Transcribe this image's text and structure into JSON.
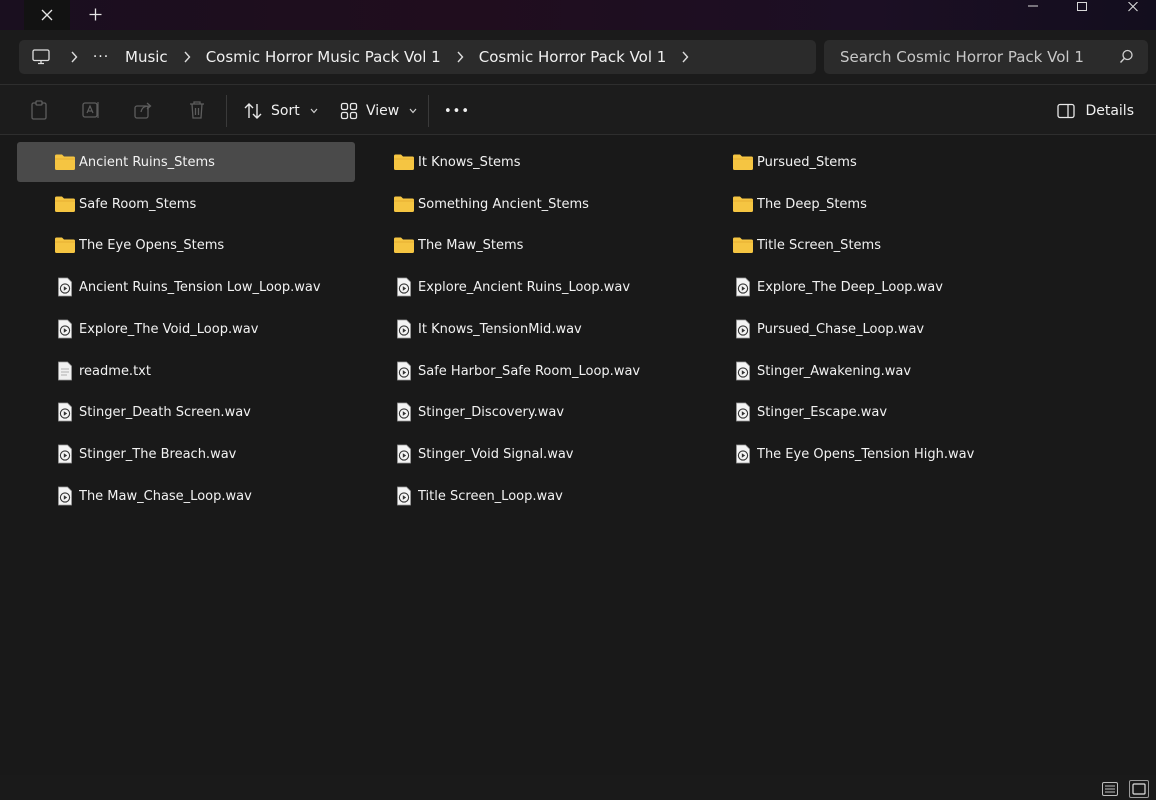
{
  "breadcrumb": {
    "more": "···",
    "segments": [
      "Music",
      "Cosmic Horror Music Pack Vol 1",
      "Cosmic Horror Pack Vol 1"
    ]
  },
  "search": {
    "placeholder": "Search Cosmic Horror Pack Vol 1"
  },
  "toolbar": {
    "sort_label": "Sort",
    "view_label": "View",
    "more_label": "•••",
    "details_label": "Details"
  },
  "colors": {
    "folder": "#f5c542",
    "accent_selected": "#4a4a4a"
  },
  "items": [
    {
      "name": "Ancient Ruins_Stems",
      "type": "folder",
      "selected": true
    },
    {
      "name": "It Knows_Stems",
      "type": "folder"
    },
    {
      "name": "Pursued_Stems",
      "type": "folder"
    },
    {
      "name": "Safe Room_Stems",
      "type": "folder"
    },
    {
      "name": "Something Ancient_Stems",
      "type": "folder"
    },
    {
      "name": "The Deep_Stems",
      "type": "folder"
    },
    {
      "name": "The Eye Opens_Stems",
      "type": "folder"
    },
    {
      "name": "The Maw_Stems",
      "type": "folder"
    },
    {
      "name": "Title Screen_Stems",
      "type": "folder"
    },
    {
      "name": "Ancient Ruins_Tension Low_Loop.wav",
      "type": "audio"
    },
    {
      "name": "Explore_Ancient Ruins_Loop.wav",
      "type": "audio"
    },
    {
      "name": "Explore_The Deep_Loop.wav",
      "type": "audio"
    },
    {
      "name": "Explore_The Void_Loop.wav",
      "type": "audio"
    },
    {
      "name": "It Knows_TensionMid.wav",
      "type": "audio"
    },
    {
      "name": "Pursued_Chase_Loop.wav",
      "type": "audio"
    },
    {
      "name": "readme.txt",
      "type": "text"
    },
    {
      "name": "Safe Harbor_Safe Room_Loop.wav",
      "type": "audio"
    },
    {
      "name": "Stinger_Awakening.wav",
      "type": "audio"
    },
    {
      "name": "Stinger_Death Screen.wav",
      "type": "audio"
    },
    {
      "name": "Stinger_Discovery.wav",
      "type": "audio"
    },
    {
      "name": "Stinger_Escape.wav",
      "type": "audio"
    },
    {
      "name": "Stinger_The Breach.wav",
      "type": "audio"
    },
    {
      "name": "Stinger_Void Signal.wav",
      "type": "audio"
    },
    {
      "name": "The Eye Opens_Tension High.wav",
      "type": "audio"
    },
    {
      "name": "The Maw_Chase_Loop.wav",
      "type": "audio"
    },
    {
      "name": "Title Screen_Loop.wav",
      "type": "audio"
    }
  ]
}
